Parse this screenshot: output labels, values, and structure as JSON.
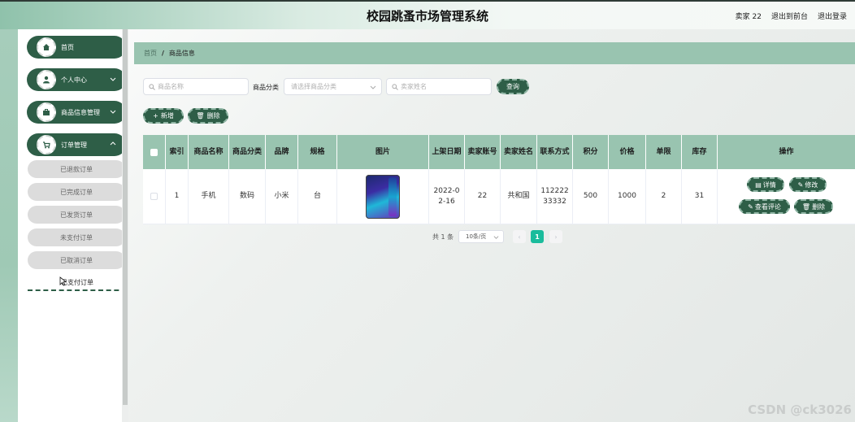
{
  "header": {
    "title": "校园跳蚤市场管理系统",
    "user": "卖家 22",
    "back_to_front": "退出到前台",
    "logout": "退出登录"
  },
  "sidebar": {
    "items": [
      {
        "label": "首页",
        "icon": "home-icon"
      },
      {
        "label": "个人中心",
        "icon": "user-icon"
      },
      {
        "label": "商品信息管理",
        "icon": "briefcase-icon"
      },
      {
        "label": "订单管理",
        "icon": "cart-icon"
      }
    ],
    "order_sub": [
      "已退款订单",
      "已完成订单",
      "已发货订单",
      "未支付订单",
      "已取消订单"
    ],
    "order_active": "已支付订单"
  },
  "breadcrumb": {
    "home": "首页",
    "separator": "/",
    "current": "商品信息"
  },
  "filters": {
    "name_placeholder": "商品名称",
    "category_label": "商品分类",
    "category_placeholder": "请选择商品分类",
    "seller_placeholder": "卖家姓名",
    "query_button": "查询"
  },
  "actions": {
    "add": "新增",
    "delete": "删除"
  },
  "table": {
    "headers": [
      "索引",
      "商品名称",
      "商品分类",
      "品牌",
      "规格",
      "图片",
      "上架日期",
      "卖家账号",
      "卖家姓名",
      "联系方式",
      "积分",
      "价格",
      "单限",
      "库存",
      "操作"
    ],
    "rows": [
      {
        "index": "1",
        "name": "手机",
        "category": "数码",
        "brand": "小米",
        "spec": "台",
        "image": "phone-image",
        "date": "2022-02-16",
        "account": "22",
        "seller": "共和国",
        "contact": "11222233332",
        "points": "500",
        "price": "1000",
        "limit": "2",
        "stock": "31"
      }
    ],
    "ops": {
      "detail": "详情",
      "edit": "修改",
      "review": "查看评论",
      "delete": "删除"
    }
  },
  "pagination": {
    "total": "共 1 条",
    "size": "10条/页",
    "current": "1",
    "prev": "‹",
    "next": "›"
  },
  "watermark": "CSDN @ck3026",
  "colors": {
    "accent": "#2e5e47",
    "header_green": "#99c4b0",
    "page_active": "#1abc9c"
  }
}
